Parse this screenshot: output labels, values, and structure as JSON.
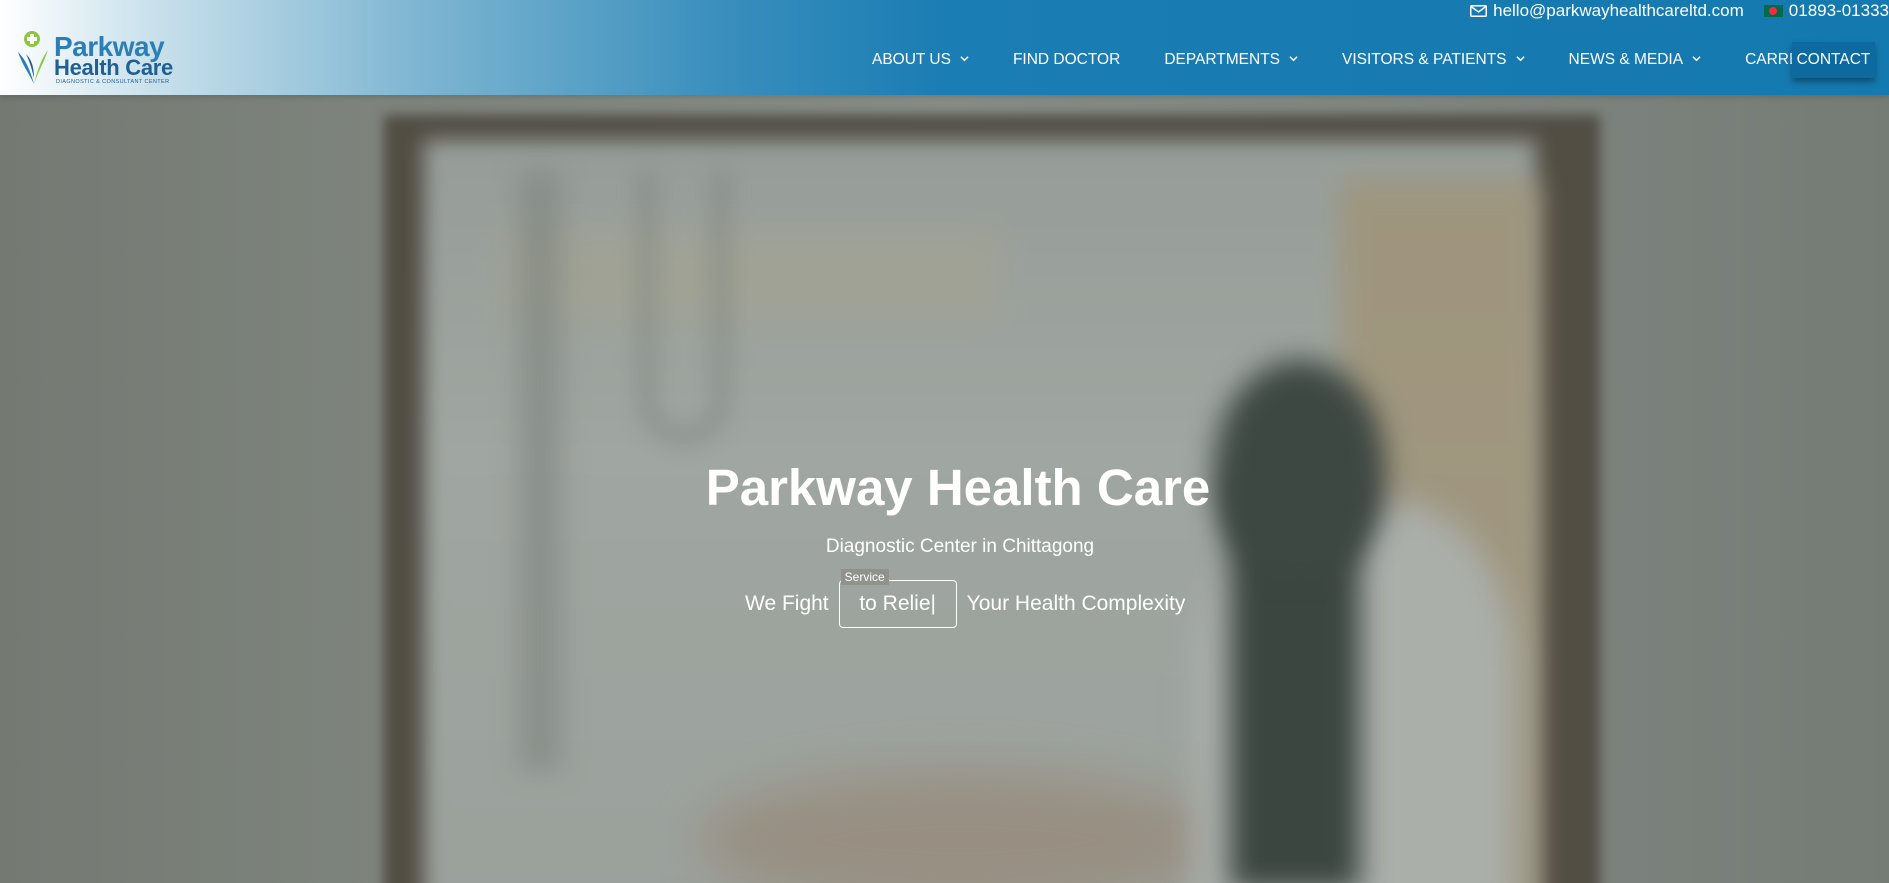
{
  "header": {
    "logo": {
      "line1": "Parkway",
      "line2": "Health Care",
      "line3": "DIAGNOSTIC & CONSULTANT CENTER"
    },
    "topbar": {
      "email": "hello@parkwayhealthcareltd.com",
      "phone": "01893-01333"
    },
    "nav": {
      "about": "ABOUT US",
      "find_doctor": "FIND DOCTOR",
      "departments": "DEPARTMENTS",
      "visitors": "VISITORS & PATIENTS",
      "news": "NEWS & MEDIA",
      "carrer": "CARRER",
      "contact": "CONTACT"
    }
  },
  "hero": {
    "title": "Parkway Health Care",
    "subtitle": "Diagnostic Center in Chittagong",
    "tagline_prefix": "We Fight",
    "rotator_label": "Service",
    "rotator_text": "to Relie|",
    "tagline_suffix": "Your Health Complexity"
  },
  "colors": {
    "header_blue": "#1479af",
    "contact_button": "#0d6aa0",
    "text_white": "#ffffff"
  },
  "icons": [
    "mail-icon",
    "bangladesh-flag-icon",
    "chevron-down-icon",
    "logo-figure-icon"
  ]
}
